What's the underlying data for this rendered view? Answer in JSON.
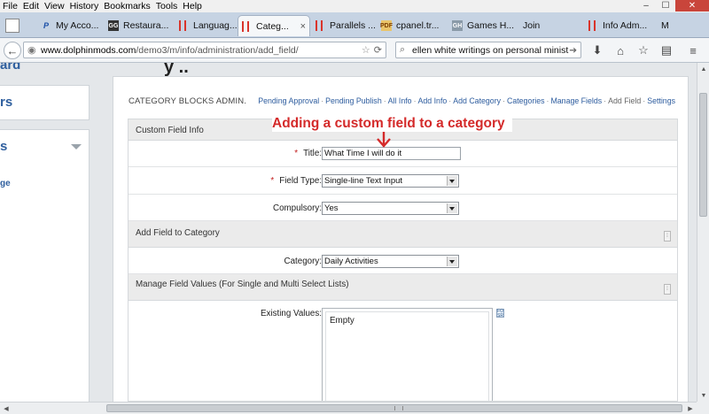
{
  "menubar": {
    "items": [
      "File",
      "Edit",
      "View",
      "History",
      "Bookmarks",
      "Tools",
      "Help"
    ]
  },
  "window_controls": {
    "minimize": "–",
    "maximize": "☐",
    "close": "✕"
  },
  "tabs": [
    {
      "label": "",
      "icon": "app-icon"
    },
    {
      "label": "My Acco...",
      "icon": "paypal-icon"
    },
    {
      "label": "Restaura...",
      "icon": "restaurant-icon"
    },
    {
      "label": "Languag...",
      "icon": "bars-icon"
    },
    {
      "label": "Categ...",
      "icon": "bars-icon",
      "active": true
    },
    {
      "label": "Parallels ...",
      "icon": "bars-icon"
    },
    {
      "label": "cpanel.tr...",
      "icon": "pdf-icon"
    },
    {
      "label": "Games H...",
      "icon": "games-icon"
    },
    {
      "label": "Join",
      "icon": ""
    },
    {
      "label": "Info Adm...",
      "icon": "bars-icon"
    },
    {
      "label": "M",
      "icon": ""
    }
  ],
  "tab_close_glyph": "×",
  "tab_icon_glyphs": {
    "paypal": "P",
    "restaurant": "GG",
    "pdf": "PDF",
    "games": "GH"
  },
  "navbar": {
    "url_host": "www.dolphinmods.com",
    "url_path": "/demo3/m/info/administration/add_field/",
    "search_value": "ellen white writings on personal ministries",
    "icons": [
      "back-icon",
      "globe-icon",
      "bookmark-star-icon",
      "reload-icon",
      "search-icon",
      "search-go-icon",
      "download-icon",
      "home-icon",
      "bookmark-icon",
      "reading-list-icon",
      "menu-icon"
    ],
    "icon_glyphs": {
      "back": "←",
      "globe": "◉",
      "star": "☆",
      "reload": "⟳",
      "search": "⌕",
      "go": "➔",
      "download": "⬇",
      "home": "⌂",
      "bookmark": "☆",
      "list": "▤",
      "menu": "≡"
    }
  },
  "left_column": {
    "box0_text": "ard",
    "box1_text": "rs",
    "box2_text": "s",
    "box2_link": "ge"
  },
  "top_cut_text": "y ..",
  "main": {
    "title": "CATEGORY BLOCKS ADMIN.",
    "admin_nav": [
      {
        "label": "Pending Approval",
        "link": true
      },
      {
        "label": "Pending Publish",
        "link": true
      },
      {
        "label": "All Info",
        "link": true
      },
      {
        "label": "Add Info",
        "link": true
      },
      {
        "label": "Add Category",
        "link": true
      },
      {
        "label": "Categories",
        "link": true
      },
      {
        "label": "Manage Fields",
        "link": true
      },
      {
        "label": "Add Field",
        "link": false
      },
      {
        "label": "Settings",
        "link": true
      }
    ],
    "admin_nav_separator": "·"
  },
  "form": {
    "section_custom_field": "Custom Field Info",
    "title_label": "Title:",
    "title_value": "What Time I will do it",
    "field_type_label": "Field Type:",
    "field_type_value": "Single-line Text Input",
    "compulsory_label": "Compulsory:",
    "compulsory_value": "Yes",
    "section_add_to_category": "Add Field to Category",
    "category_label": "Category:",
    "category_value": "Daily Activities",
    "section_manage_values": "Manage Field Values (For Single and Multi Select Lists)",
    "existing_values_label": "Existing Values:",
    "existing_values_text": "Empty",
    "required_marker": "*",
    "section_icon_glyph": "⁞",
    "existing_icon_text": "FO SR"
  },
  "annotation": {
    "text": "Adding a custom field to a category",
    "color": "#d42a2a"
  },
  "scroll_glyphs": {
    "up": "▲",
    "down": "▼",
    "left": "◀",
    "right": "▶"
  }
}
